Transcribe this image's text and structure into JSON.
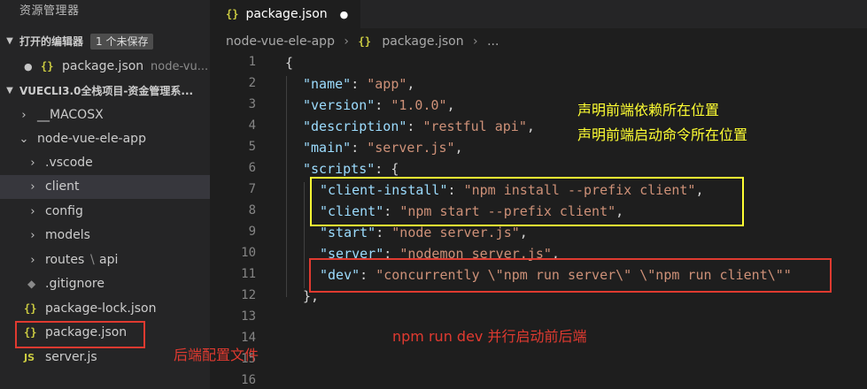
{
  "sidebar": {
    "title": "资源管理器",
    "open_editors": {
      "label": "打开的编辑器",
      "badge": "1 个未保存"
    },
    "open_file": {
      "name": "package.json",
      "path": "node-vu..."
    },
    "project": {
      "label": "VUECLI3.0全栈项目-资金管理系..."
    },
    "tree": [
      {
        "label": "__MACOSX"
      },
      {
        "label": "node-vue-ele-app"
      },
      {
        "label": ".vscode"
      },
      {
        "label": "client"
      },
      {
        "label": "config"
      },
      {
        "label": "models"
      },
      {
        "label": "routes",
        "sub": "api"
      },
      {
        "label": ".gitignore"
      },
      {
        "label": "package-lock.json"
      },
      {
        "label": "package.json"
      },
      {
        "label": "server.js"
      }
    ],
    "icons": {
      "json": "{}",
      "js": "JS"
    }
  },
  "editor": {
    "tab": {
      "label": "package.json"
    },
    "breadcrumb": {
      "folder": "node-vue-ele-app",
      "file": "package.json",
      "more": "..."
    },
    "line_numbers": [
      "1",
      "2",
      "3",
      "4",
      "5",
      "6",
      "7",
      "8",
      "9",
      "10",
      "11",
      "12",
      "13",
      "14",
      "15",
      "16"
    ],
    "code": {
      "l1": "{",
      "l2k": "\"name\"",
      "l2v": "\"app\"",
      "l3k": "\"version\"",
      "l3v": "\"1.0.0\"",
      "l4k": "\"description\"",
      "l4v": "\"restful api\"",
      "l5k": "\"main\"",
      "l5v": "\"server.js\"",
      "l6k": "\"scripts\"",
      "l7k": "\"client-install\"",
      "l7v": "\"npm install --prefix client\"",
      "l8k": "\"client\"",
      "l8v": "\"npm start --prefix client\"",
      "l9k": "\"start\"",
      "l9v": "\"node server.js\"",
      "l10k": "\"server\"",
      "l10v": "\"nodemon server.js\"",
      "l11k": "\"dev\"",
      "l11v": "\"concurrently \\\"npm run server\\\" \\\"npm run client\\\"\"",
      "l12": "},"
    }
  },
  "annotations": {
    "frontend_deps": "声明前端依赖所在位置",
    "frontend_start": "声明前端启动命令所在位置",
    "dev_note": "npm run dev 并行启动前后端",
    "backend_config": "后端配置文件"
  },
  "colors": {
    "yellow": "#ffff33",
    "red": "#e03a30"
  }
}
